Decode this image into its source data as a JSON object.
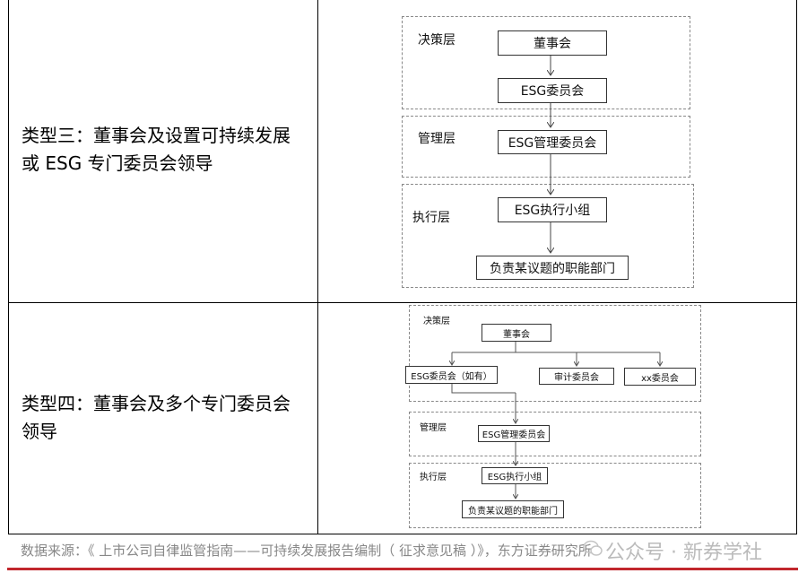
{
  "rows": [
    {
      "label_line1": "类型三：董事会及设置可持续发展",
      "label_line2": "或 ESG 专门委员会领导",
      "diagram": {
        "layers": [
          "决策层",
          "管理层",
          "执行层"
        ],
        "boxes": [
          "董事会",
          "ESG委员会",
          "ESG管理委员会",
          "ESG执行小组",
          "负责某议题的职能部门"
        ]
      }
    },
    {
      "label_line1": "类型四：董事会及多个专门委员会",
      "label_line2": "领导",
      "diagram": {
        "layers": [
          "决策层",
          "管理层",
          "执行层"
        ],
        "boxes": [
          "董事会",
          "ESG委员会（如有）",
          "审计委员会",
          "xx委员会",
          "ESG管理委员会",
          "ESG执行小组",
          "负责某议题的职能部门"
        ]
      }
    }
  ],
  "footer": {
    "source": "数据来源：《 上市公司自律监管指南——可持续发展报告编制（ 征求意见稿 ）》，东方证券研究所",
    "watermark": "公众号 · 新券学社"
  }
}
